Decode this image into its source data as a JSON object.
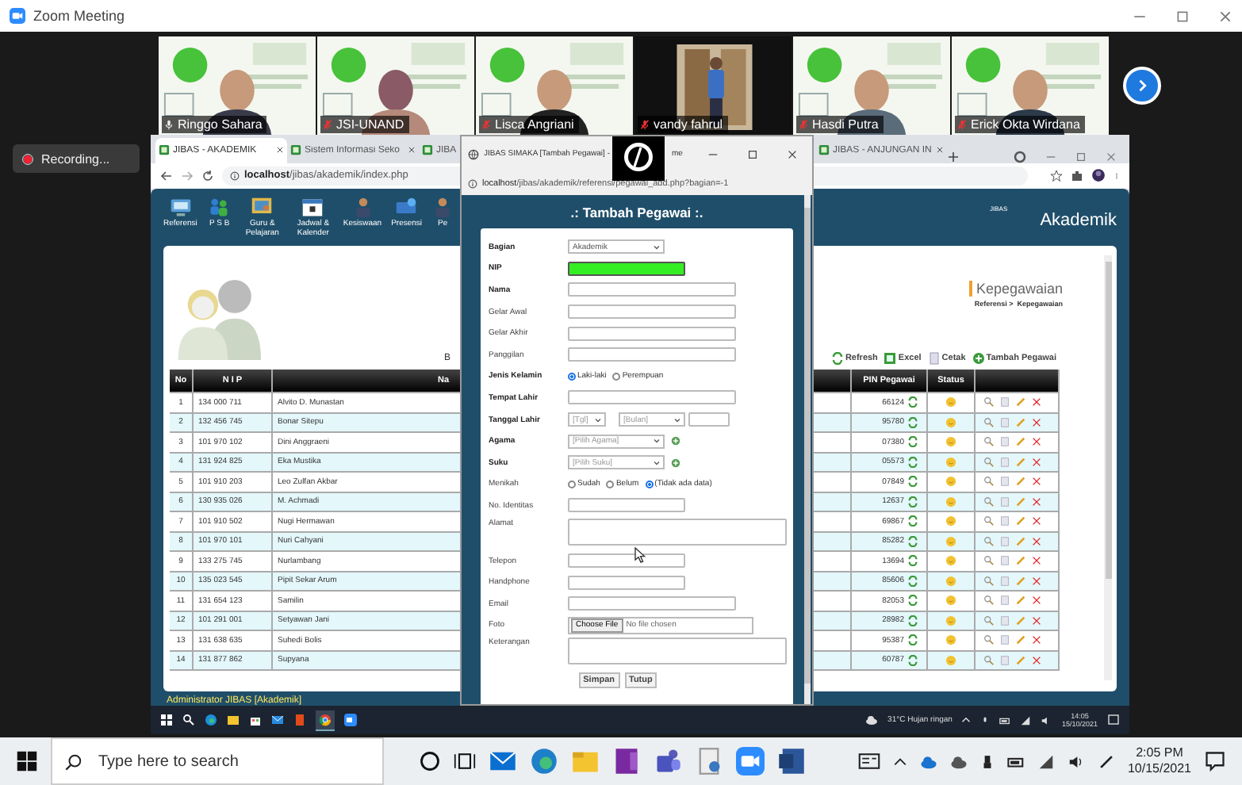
{
  "window": {
    "title": "Zoom Meeting"
  },
  "participants": [
    {
      "name": "Ringgo Sahara",
      "muted": false
    },
    {
      "name": "JSI-UNAND",
      "muted": true
    },
    {
      "name": "Lisca Angriani",
      "muted": true
    },
    {
      "name": "vandy fahrul",
      "muted": true
    },
    {
      "name": "Hasdi Putra",
      "muted": true
    },
    {
      "name": "Erick Okta Wirdana",
      "muted": true
    }
  ],
  "recording": {
    "label": "Recording..."
  },
  "browser": {
    "tabs": [
      {
        "label": "JIBAS - AKADEMIK",
        "selected": true
      },
      {
        "label": "Sistem Informasi Seko",
        "selected": false
      },
      {
        "label": "JIBA",
        "selected": false
      },
      {
        "label": "JIBAS - ANJUNGAN IN",
        "selected": false
      }
    ],
    "address": "**localhost**/jibas/akademik/index.php"
  },
  "app": {
    "logo_small": "JIBAS",
    "logo": "Akademik",
    "menu": [
      {
        "label": "Referensi",
        "kind": "monitor"
      },
      {
        "label": "P S B",
        "kind": "people"
      },
      {
        "label": "Guru & Pelajaran",
        "kind": "board"
      },
      {
        "label": "Jadwal & Kalender",
        "kind": "calendar"
      },
      {
        "label": "Kesiswaan",
        "kind": "person"
      },
      {
        "label": "Presensi",
        "kind": "card"
      },
      {
        "label": "Pe",
        "kind": "person"
      }
    ],
    "cut_label": "B",
    "section_title": "Kepegawaian",
    "breadcrumb": "Referensi >  Kepegawaian",
    "actions": [
      {
        "label": "Refresh",
        "kind": "refresh"
      },
      {
        "label": "Excel",
        "kind": "excel"
      },
      {
        "label": "Cetak",
        "kind": "print"
      },
      {
        "label": "Tambah Pegawai",
        "kind": "add"
      }
    ],
    "table": {
      "columns": [
        "No",
        "N I P",
        "Na",
        "PIN Pegawai",
        "Status"
      ],
      "rows": [
        {
          "no": "1",
          "nip": "134 000 711",
          "name": "Alvito D. Munastan",
          "pin": "66124"
        },
        {
          "no": "2",
          "nip": "132 456 745",
          "name": "Bonar Sitepu",
          "pin": "95780"
        },
        {
          "no": "3",
          "nip": "101 970 102",
          "name": "Dini Anggraeni",
          "pin": "07380"
        },
        {
          "no": "4",
          "nip": "131 924 825",
          "name": "Eka Mustika",
          "pin": "05573"
        },
        {
          "no": "5",
          "nip": "101 910 203",
          "name": "Leo Zulfan Akbar",
          "pin": "07849"
        },
        {
          "no": "6",
          "nip": "130 935 026",
          "name": "M. Achmadi",
          "pin": "12637"
        },
        {
          "no": "7",
          "nip": "101 910 502",
          "name": "Nugi Hermawan",
          "pin": "69867"
        },
        {
          "no": "8",
          "nip": "101 970 101",
          "name": "Nuri Cahyani",
          "pin": "85282"
        },
        {
          "no": "9",
          "nip": "133 275 745",
          "name": "Nurlambang",
          "pin": "13694"
        },
        {
          "no": "10",
          "nip": "135 023 545",
          "name": "Pipit Sekar Arum",
          "pin": "85606"
        },
        {
          "no": "11",
          "nip": "131 654 123",
          "name": "Samilin",
          "pin": "82053"
        },
        {
          "no": "12",
          "nip": "101 291 001",
          "name": "Setyawan Jani",
          "pin": "28982"
        },
        {
          "no": "13",
          "nip": "131 638 635",
          "name": "Suhedi Bolis",
          "pin": "95387"
        },
        {
          "no": "14",
          "nip": "131 877 862",
          "name": "Supyana",
          "pin": "60787"
        }
      ]
    },
    "status": "Administrator JIBAS [Akademik]"
  },
  "popup": {
    "title": "JIBAS SIMAKA [Tambah Pegawai] -",
    "title_tail": "me",
    "address": "**localhost**/jibas/akademik/referensi/pegawai_add.php?bagian=-1",
    "heading": ".: Tambah Pegawai :.",
    "fields": [
      {
        "label": "Bagian",
        "required": true,
        "kind": "select",
        "value": "Akademik"
      },
      {
        "label": "NIP",
        "required": true,
        "kind": "highlight"
      },
      {
        "label": "Nama",
        "required": true,
        "kind": "text"
      },
      {
        "label": "Gelar Awal",
        "required": false,
        "kind": "text"
      },
      {
        "label": "Gelar Akhir",
        "required": false,
        "kind": "text"
      },
      {
        "label": "Panggilan",
        "required": false,
        "kind": "text"
      },
      {
        "label": "Jenis Kelamin",
        "required": true,
        "kind": "radio",
        "options": [
          {
            "label": "Laki-laki",
            "selected": true
          },
          {
            "label": "Perempuan",
            "selected": false
          }
        ]
      },
      {
        "label": "Tempat Lahir",
        "required": true,
        "kind": "text"
      },
      {
        "label": "Tanggal Lahir",
        "required": true,
        "kind": "date",
        "day": "[Tgl]",
        "month": "[Bulan]"
      },
      {
        "label": "Agama",
        "required": true,
        "kind": "select_add",
        "value": "[Pilih Agama]"
      },
      {
        "label": "Suku",
        "required": true,
        "kind": "select_add",
        "value": "[Pilih Suku]"
      },
      {
        "label": "Menikah",
        "required": false,
        "kind": "radio",
        "options": [
          {
            "label": "Sudah",
            "selected": false
          },
          {
            "label": "Belum",
            "selected": false
          },
          {
            "label": "(Tidak ada data)",
            "selected": true
          }
        ]
      },
      {
        "label": "No. Identitas",
        "required": false,
        "kind": "text_short"
      },
      {
        "label": "Alamat",
        "required": false,
        "kind": "textarea"
      },
      {
        "label": "Telepon",
        "required": false,
        "kind": "text_short"
      },
      {
        "label": "Handphone",
        "required": false,
        "kind": "text_short"
      },
      {
        "label": "Email",
        "required": false,
        "kind": "text"
      },
      {
        "label": "Foto",
        "required": false,
        "kind": "file",
        "button": "Choose File",
        "status": "No file chosen"
      },
      {
        "label": "Keterangan",
        "required": false,
        "kind": "textarea"
      }
    ],
    "buttons": [
      "Simpan",
      "Tutup"
    ]
  },
  "inner_taskbar": {
    "weather": "31°C  Hujan ringan",
    "time": "14:05",
    "date": "15/10/2021"
  },
  "taskbar": {
    "search_placeholder": "Type here to search",
    "time": "2:05 PM",
    "date": "10/15/2021"
  }
}
